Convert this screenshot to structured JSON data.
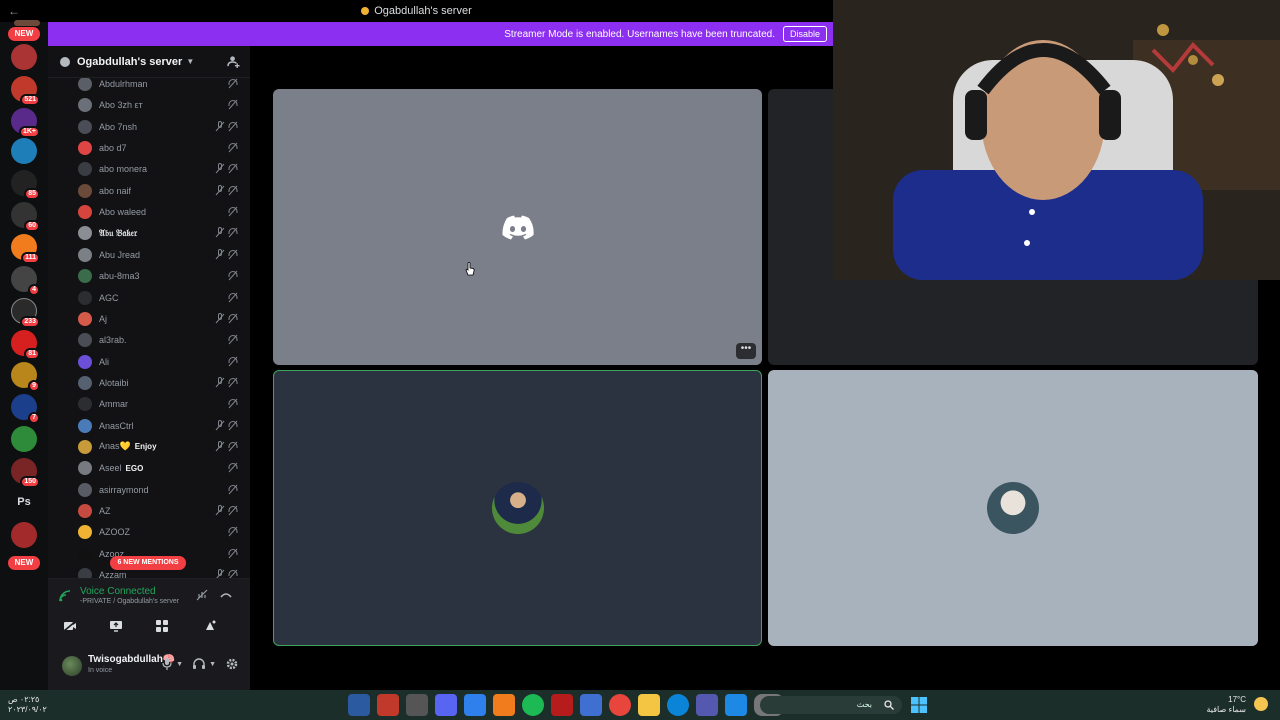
{
  "titlebar": {
    "back_icon": "arrow-left-icon",
    "title": "Ogabdullah's server"
  },
  "banner": {
    "message": "Streamer Mode is enabled. Usernames have been truncated.",
    "disable_label": "Disable"
  },
  "rail": {
    "top_new": "NEW",
    "bottom_new": "NEW",
    "ps_label": "Ps",
    "badges": [
      "521",
      "1K+",
      "85",
      "60",
      "111",
      "4",
      "233",
      "81",
      "9",
      "7",
      "150"
    ]
  },
  "server": {
    "name": "Ogabdullah's server",
    "invite_icon": "add-member-icon",
    "chevron_icon": "chevron-down-icon"
  },
  "members": [
    {
      "name": "Abdulrhman",
      "bold": false
    },
    {
      "name": "Abo 3zh εт",
      "bold": false
    },
    {
      "name": "Abo 7nsh",
      "bold": false
    },
    {
      "name": "abo d7",
      "bold": false
    },
    {
      "name": "abo monera",
      "bold": false
    },
    {
      "name": "abo naif",
      "bold": false
    },
    {
      "name": "Abo waleed",
      "bold": false
    },
    {
      "name": "𝔄𝔟𝔲 𝔅𝔞𝔨𝔢𝔯",
      "bold": true
    },
    {
      "name": "Abu Jread",
      "bold": false
    },
    {
      "name": "abu-8ma3",
      "bold": false
    },
    {
      "name": "AGC",
      "bold": false
    },
    {
      "name": "Aj",
      "bold": false
    },
    {
      "name": "al3rab.",
      "bold": false
    },
    {
      "name": "Ali",
      "bold": false
    },
    {
      "name": "Alotaibi",
      "bold": false
    },
    {
      "name": "Ammar",
      "bold": false
    },
    {
      "name": "AnasCtrl",
      "bold": false
    },
    {
      "name": "Anas💛",
      "bold": false,
      "tag": "Enjoy"
    },
    {
      "name": "Aseel",
      "bold": false,
      "tag": "EGO"
    },
    {
      "name": "asirraymond",
      "bold": false
    },
    {
      "name": "AZ",
      "bold": false
    },
    {
      "name": "AZOOZ",
      "bold": false
    },
    {
      "name": "Azooz",
      "bold": false
    },
    {
      "name": "Azzam",
      "bold": false
    }
  ],
  "mentions_label": "6 NEW MENTIONS",
  "voice": {
    "status": "Voice Connected",
    "channel": "-PRIVATE / Ogabdullah's server",
    "icons": [
      "camera-off-icon",
      "screen-share-icon",
      "activities-icon",
      "soundboard-icon",
      "noise-suppression-icon",
      "disconnect-icon"
    ]
  },
  "user": {
    "name": "Twisogabdullah🧠",
    "status": "In voice",
    "icons": [
      "microphone-icon",
      "headphones-icon",
      "settings-icon"
    ]
  },
  "stage": {
    "tile_more_label": "•••"
  },
  "taskbar": {
    "time": "٠٢:٢٥ ص",
    "date": "٢٠٢٣/٠٩/٠٢",
    "search_label": "بحث",
    "weather_temp": "17°C",
    "weather_desc": "سماء صافية"
  },
  "colors": {
    "brand": "#8c2ff0",
    "online_green": "#23a55a",
    "alert_red": "#f23f43",
    "speaking_border": "#3ba55d"
  }
}
